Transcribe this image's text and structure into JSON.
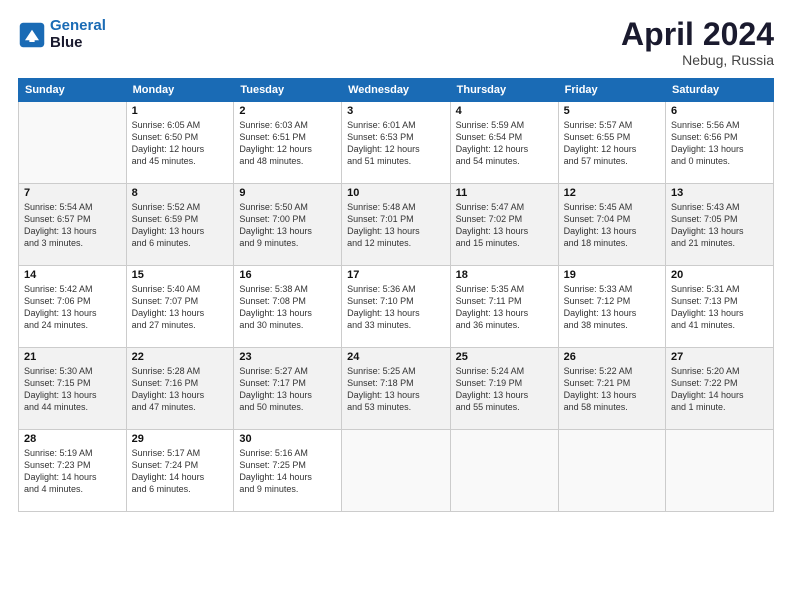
{
  "header": {
    "logo_line1": "General",
    "logo_line2": "Blue",
    "month": "April 2024",
    "location": "Nebug, Russia"
  },
  "weekdays": [
    "Sunday",
    "Monday",
    "Tuesday",
    "Wednesday",
    "Thursday",
    "Friday",
    "Saturday"
  ],
  "weeks": [
    [
      {
        "day": "",
        "info": ""
      },
      {
        "day": "1",
        "info": "Sunrise: 6:05 AM\nSunset: 6:50 PM\nDaylight: 12 hours\nand 45 minutes."
      },
      {
        "day": "2",
        "info": "Sunrise: 6:03 AM\nSunset: 6:51 PM\nDaylight: 12 hours\nand 48 minutes."
      },
      {
        "day": "3",
        "info": "Sunrise: 6:01 AM\nSunset: 6:53 PM\nDaylight: 12 hours\nand 51 minutes."
      },
      {
        "day": "4",
        "info": "Sunrise: 5:59 AM\nSunset: 6:54 PM\nDaylight: 12 hours\nand 54 minutes."
      },
      {
        "day": "5",
        "info": "Sunrise: 5:57 AM\nSunset: 6:55 PM\nDaylight: 12 hours\nand 57 minutes."
      },
      {
        "day": "6",
        "info": "Sunrise: 5:56 AM\nSunset: 6:56 PM\nDaylight: 13 hours\nand 0 minutes."
      }
    ],
    [
      {
        "day": "7",
        "info": "Sunrise: 5:54 AM\nSunset: 6:57 PM\nDaylight: 13 hours\nand 3 minutes."
      },
      {
        "day": "8",
        "info": "Sunrise: 5:52 AM\nSunset: 6:59 PM\nDaylight: 13 hours\nand 6 minutes."
      },
      {
        "day": "9",
        "info": "Sunrise: 5:50 AM\nSunset: 7:00 PM\nDaylight: 13 hours\nand 9 minutes."
      },
      {
        "day": "10",
        "info": "Sunrise: 5:48 AM\nSunset: 7:01 PM\nDaylight: 13 hours\nand 12 minutes."
      },
      {
        "day": "11",
        "info": "Sunrise: 5:47 AM\nSunset: 7:02 PM\nDaylight: 13 hours\nand 15 minutes."
      },
      {
        "day": "12",
        "info": "Sunrise: 5:45 AM\nSunset: 7:04 PM\nDaylight: 13 hours\nand 18 minutes."
      },
      {
        "day": "13",
        "info": "Sunrise: 5:43 AM\nSunset: 7:05 PM\nDaylight: 13 hours\nand 21 minutes."
      }
    ],
    [
      {
        "day": "14",
        "info": "Sunrise: 5:42 AM\nSunset: 7:06 PM\nDaylight: 13 hours\nand 24 minutes."
      },
      {
        "day": "15",
        "info": "Sunrise: 5:40 AM\nSunset: 7:07 PM\nDaylight: 13 hours\nand 27 minutes."
      },
      {
        "day": "16",
        "info": "Sunrise: 5:38 AM\nSunset: 7:08 PM\nDaylight: 13 hours\nand 30 minutes."
      },
      {
        "day": "17",
        "info": "Sunrise: 5:36 AM\nSunset: 7:10 PM\nDaylight: 13 hours\nand 33 minutes."
      },
      {
        "day": "18",
        "info": "Sunrise: 5:35 AM\nSunset: 7:11 PM\nDaylight: 13 hours\nand 36 minutes."
      },
      {
        "day": "19",
        "info": "Sunrise: 5:33 AM\nSunset: 7:12 PM\nDaylight: 13 hours\nand 38 minutes."
      },
      {
        "day": "20",
        "info": "Sunrise: 5:31 AM\nSunset: 7:13 PM\nDaylight: 13 hours\nand 41 minutes."
      }
    ],
    [
      {
        "day": "21",
        "info": "Sunrise: 5:30 AM\nSunset: 7:15 PM\nDaylight: 13 hours\nand 44 minutes."
      },
      {
        "day": "22",
        "info": "Sunrise: 5:28 AM\nSunset: 7:16 PM\nDaylight: 13 hours\nand 47 minutes."
      },
      {
        "day": "23",
        "info": "Sunrise: 5:27 AM\nSunset: 7:17 PM\nDaylight: 13 hours\nand 50 minutes."
      },
      {
        "day": "24",
        "info": "Sunrise: 5:25 AM\nSunset: 7:18 PM\nDaylight: 13 hours\nand 53 minutes."
      },
      {
        "day": "25",
        "info": "Sunrise: 5:24 AM\nSunset: 7:19 PM\nDaylight: 13 hours\nand 55 minutes."
      },
      {
        "day": "26",
        "info": "Sunrise: 5:22 AM\nSunset: 7:21 PM\nDaylight: 13 hours\nand 58 minutes."
      },
      {
        "day": "27",
        "info": "Sunrise: 5:20 AM\nSunset: 7:22 PM\nDaylight: 14 hours\nand 1 minute."
      }
    ],
    [
      {
        "day": "28",
        "info": "Sunrise: 5:19 AM\nSunset: 7:23 PM\nDaylight: 14 hours\nand 4 minutes."
      },
      {
        "day": "29",
        "info": "Sunrise: 5:17 AM\nSunset: 7:24 PM\nDaylight: 14 hours\nand 6 minutes."
      },
      {
        "day": "30",
        "info": "Sunrise: 5:16 AM\nSunset: 7:25 PM\nDaylight: 14 hours\nand 9 minutes."
      },
      {
        "day": "",
        "info": ""
      },
      {
        "day": "",
        "info": ""
      },
      {
        "day": "",
        "info": ""
      },
      {
        "day": "",
        "info": ""
      }
    ]
  ]
}
